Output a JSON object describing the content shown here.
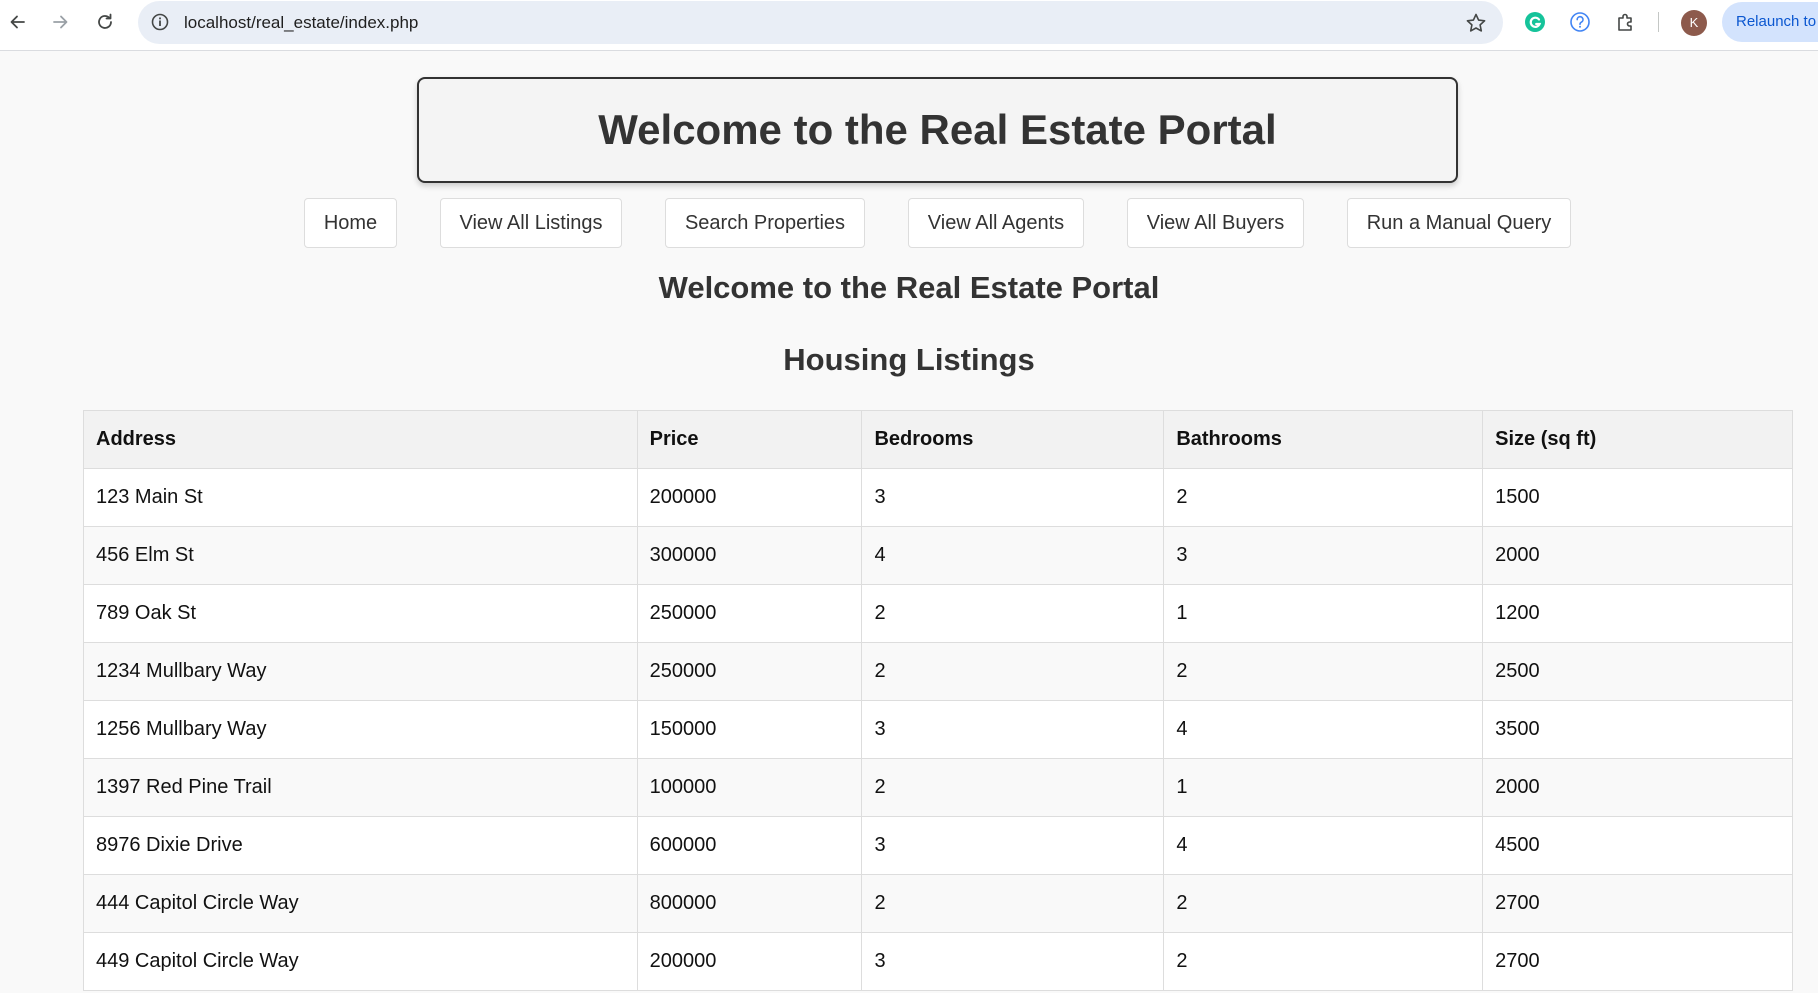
{
  "browser": {
    "url": "localhost/real_estate/index.php",
    "profile_initial": "K",
    "relaunch_label": "Relaunch to"
  },
  "header": {
    "title": "Welcome to the Real Estate Portal"
  },
  "nav": {
    "items": [
      {
        "label": "Home"
      },
      {
        "label": "View All Listings"
      },
      {
        "label": "Search Properties"
      },
      {
        "label": "View All Agents"
      },
      {
        "label": "View All Buyers"
      },
      {
        "label": "Run a Manual Query"
      }
    ]
  },
  "main": {
    "welcome": "Welcome to the Real Estate Portal",
    "listings_title": "Housing Listings"
  },
  "table": {
    "columns": [
      "Address",
      "Price",
      "Bedrooms",
      "Bathrooms",
      "Size (sq ft)"
    ],
    "rows": [
      [
        "123 Main St",
        "200000",
        "3",
        "2",
        "1500"
      ],
      [
        "456 Elm St",
        "300000",
        "4",
        "3",
        "2000"
      ],
      [
        "789 Oak St",
        "250000",
        "2",
        "1",
        "1200"
      ],
      [
        "1234 Mullbary Way",
        "250000",
        "2",
        "2",
        "2500"
      ],
      [
        "1256 Mullbary Way",
        "150000",
        "3",
        "4",
        "3500"
      ],
      [
        "1397 Red Pine Trail",
        "100000",
        "2",
        "1",
        "2000"
      ],
      [
        "8976 Dixie Drive",
        "600000",
        "3",
        "4",
        "4500"
      ],
      [
        "444 Capitol Circle Way",
        "800000",
        "2",
        "2",
        "2700"
      ],
      [
        "449 Capitol Circle Way",
        "200000",
        "3",
        "2",
        "2700"
      ]
    ]
  },
  "colors": {
    "page_bg": "#f9f9f9",
    "text": "#333333",
    "omnibox_bg": "#e9eef6",
    "relaunch_bg": "#d3e3fd",
    "grammarly_green": "#15c39a",
    "help_blue": "#4285f4",
    "avatar_bg": "#8d5a4c"
  },
  "icons": {
    "back": "arrow-left-icon",
    "forward": "arrow-right-icon",
    "reload": "reload-icon",
    "site_info": "info-icon",
    "bookmark": "star-icon",
    "grammarly": "grammarly-icon",
    "help": "help-icon",
    "extensions": "puzzle-icon"
  }
}
